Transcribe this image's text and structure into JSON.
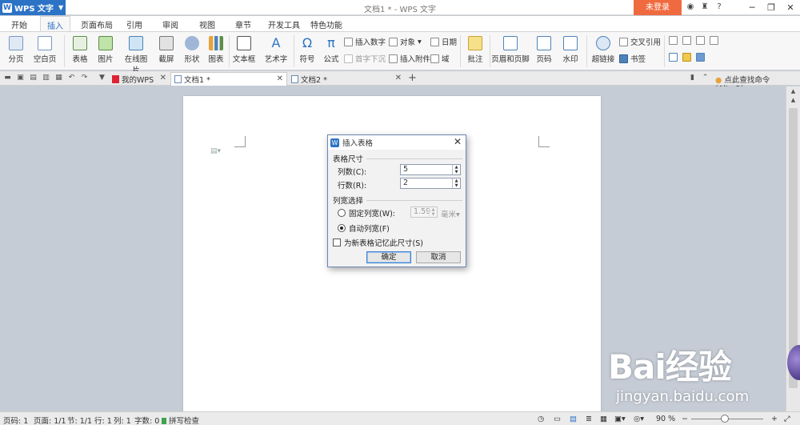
{
  "titlebar": {
    "app_menu_label": "WPS 文字",
    "window_title": "文档1 * - WPS 文字",
    "login_label": "未登录",
    "controls": [
      "─",
      "❐",
      "✕"
    ]
  },
  "menu_tabs": [
    "开始",
    "插入",
    "页面布局",
    "引用",
    "审阅",
    "视图",
    "章节",
    "开发工具",
    "特色功能"
  ],
  "ribbon": {
    "big_buttons": [
      "分页",
      "空白页",
      "表格",
      "图片",
      "在线图片",
      "截屏",
      "形状",
      "图表",
      "文本框",
      "艺术字",
      "符号",
      "公式",
      "批注",
      "页眉和页脚",
      "页码",
      "水印",
      "超链接"
    ],
    "small_buttons": [
      "插入数字",
      "对象",
      "日期",
      "首字下沉",
      "插入附件",
      "域",
      "交叉引用",
      "书签"
    ]
  },
  "doc_tabs": {
    "tabs": [
      "我的WPS",
      "文档1 *",
      "文档2 *"
    ],
    "command_search": "点此查找命令 (Alt+Q)"
  },
  "dialog": {
    "title": "插入表格",
    "size_group": "表格尺寸",
    "columns_label": "列数(C):",
    "columns_value": "5",
    "rows_label": "行数(R):",
    "rows_value": "2",
    "width_group": "列宽选择",
    "fixed_width_label": "固定列宽(W):",
    "fixed_width_value": "1.59",
    "fixed_width_unit": "毫米",
    "auto_width_label": "自动列宽(F)",
    "remember_label": "为新表格记忆此尺寸(S)",
    "ok_label": "确定",
    "cancel_label": "取消"
  },
  "statusbar": {
    "page_num": "页码: 1",
    "pages": "页面: 1/1",
    "section": "节: 1/1",
    "row": "行: 1",
    "col": "列: 1",
    "words": "字数: 0",
    "spell": "拼写检查",
    "zoom": "90 %"
  },
  "watermark": {
    "brand": "Bai经验",
    "url": "jingyan.baidu.com"
  },
  "colors": {
    "accent": "#2c73c6",
    "login": "#ef6b3f",
    "workspace": "#c6ccd6"
  }
}
